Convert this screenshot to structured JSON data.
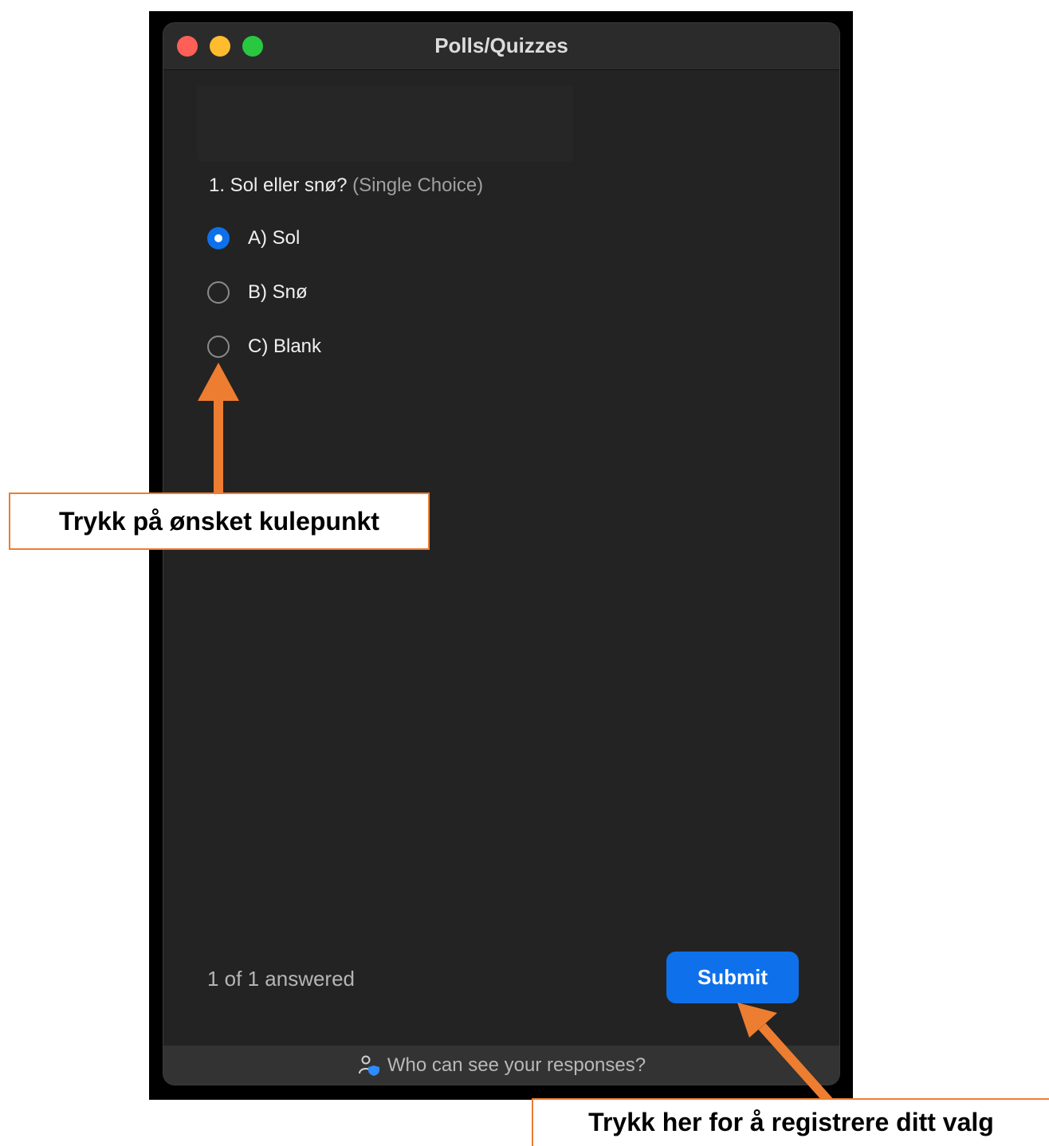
{
  "window": {
    "title": "Polls/Quizzes"
  },
  "question": {
    "text": "1. Sol eller snø?",
    "type_label": "(Single Choice)"
  },
  "options": [
    {
      "label": "A) Sol",
      "selected": true
    },
    {
      "label": "B) Snø",
      "selected": false
    },
    {
      "label": "C) Blank",
      "selected": false
    }
  ],
  "status": {
    "answered": "1 of 1 answered"
  },
  "actions": {
    "submit_label": "Submit"
  },
  "footer": {
    "text": "Who can see your responses?",
    "icon": "privacy-user-shield-icon"
  },
  "annotations": {
    "choose_callout": "Trykk på ønsket kulepunkt",
    "submit_callout": "Trykk her for å registrere ditt valg",
    "arrow_color": "#ed7d31"
  },
  "colors": {
    "accent": "#0e71eb",
    "window_bg": "#232323"
  }
}
